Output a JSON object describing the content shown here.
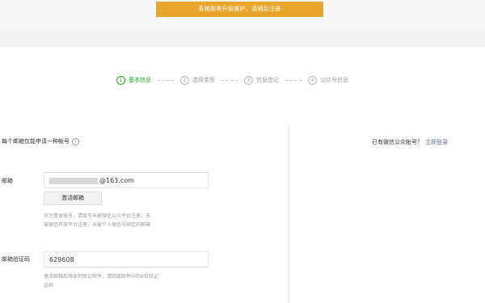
{
  "notice": "系统即将升级维护，请稍后注册",
  "steps": [
    {
      "num": "1",
      "label": "基本信息"
    },
    {
      "num": "2",
      "label": "选择类型"
    },
    {
      "num": "3",
      "label": "信息登记"
    },
    {
      "num": "4",
      "label": "公众号信息"
    }
  ],
  "form": {
    "note": "每个邮箱仅能申请一种帐号",
    "info_icon": "i",
    "email_label": "邮箱",
    "email_suffix": "@163.com",
    "activate_button": "激活邮箱",
    "email_hint_1": "作为登录帐号，请填写未被微信公众平台注册，未",
    "email_hint_2": "被微信开放平台注册，未被个人微信号绑定的邮箱",
    "code_label": "邮箱验证码",
    "code_value": "629608",
    "code_hint_1": "激活邮箱后将收到验证邮件，请回填邮件中的6位验证",
    "code_hint_2": "证码"
  },
  "right": {
    "question": "已有微信公众帐号？",
    "login_link": "立即登录"
  },
  "colors": {
    "notice_bg": "#e8a72c",
    "active_step": "#1aad19",
    "link": "#576b95"
  }
}
